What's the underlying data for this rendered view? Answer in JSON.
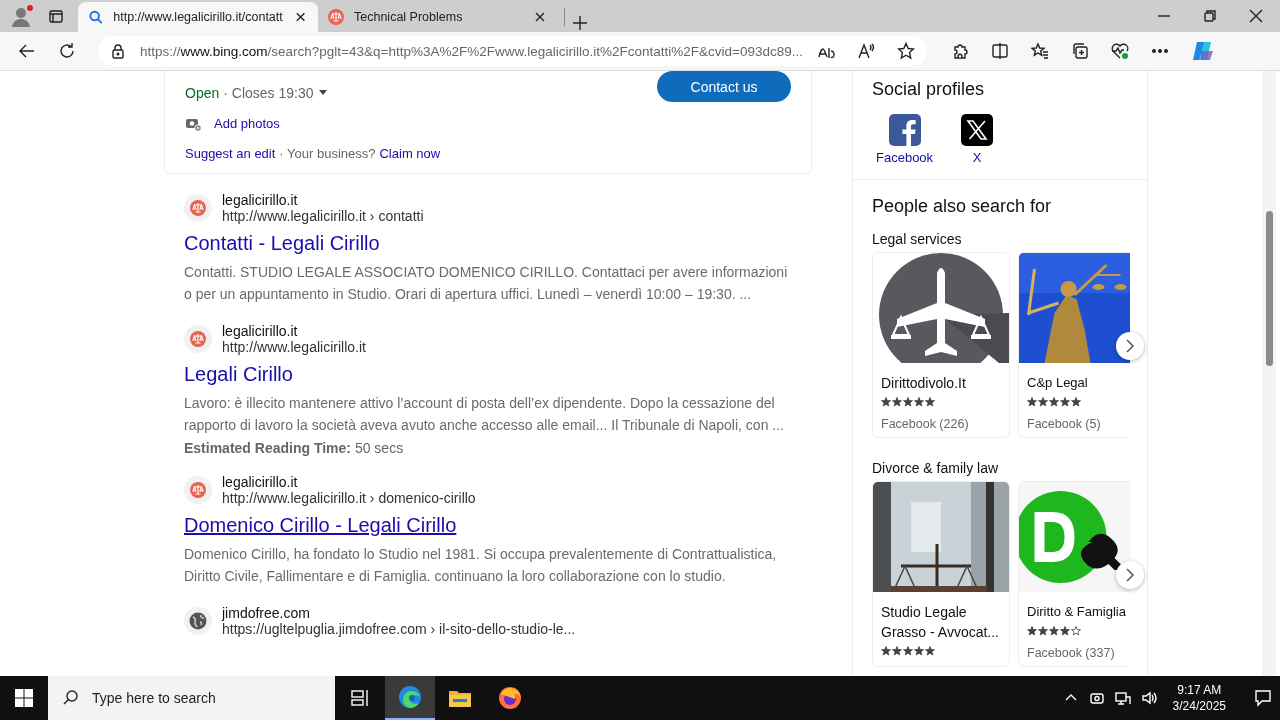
{
  "browser": {
    "tabs": [
      {
        "title": "http://www.legalicirillo.it/contatt",
        "kind": "search",
        "selected": true
      },
      {
        "title": "Technical Problems",
        "kind": "scales",
        "selected": false
      }
    ],
    "address": {
      "scheme": "https://",
      "host": "www.bing.com",
      "path": "/search?pglt=43&q=http%3A%2F%2Fwww.legalicirillo.it%2Fcontatti%2F&cvid=093dc89..."
    }
  },
  "business": {
    "status": "Open",
    "hours": "· Closes 19:30",
    "contact_button": "Contact us",
    "add_photos": "Add photos",
    "suggest_edit": "Suggest an edit",
    "your_business": "· Your business?",
    "claim": "Claim now"
  },
  "results": [
    {
      "kind": "scales",
      "site": "legalicirillo.it",
      "url": "http://www.legalicirillo.it › contatti",
      "title": "Contatti - Legali Cirillo",
      "hovered": false,
      "snippet": "Contatti. STUDIO LEGALE ASSOCIATO DOMENICO CIRILLO. Contattaci per avere informazioni o per un appuntamento in Studio. Orari di apertura uffici. Lunedì – venerdì 10:00 – 19:30. ..."
    },
    {
      "kind": "scales",
      "site": "legalicirillo.it",
      "url": "http://www.legalicirillo.it",
      "title": "Legali Cirillo",
      "hovered": false,
      "snippet": "Lavoro: è illecito mantenere attivo l’account di posta dell’ex dipendente. Dopo la cessazione del rapporto di lavoro la società aveva avuto anche accesso alle email... Il Tribunale di Napoli, con ...",
      "meta": "**Estimated Reading Time:** 50 secs"
    },
    {
      "kind": "scales",
      "site": "legalicirillo.it",
      "url": "http://www.legalicirillo.it › domenico-cirillo",
      "title": "Domenico Cirillo - Legali Cirillo",
      "hovered": true,
      "snippet": "Domenico Cirillo, ha fondato lo Studio nel 1981. Si occupa prevalentemente di Contrattualistica, Diritto Civile, Fallimentare e di Famiglia. continuano la loro collaborazione con lo studio."
    },
    {
      "kind": "globe",
      "site": "jimdofree.com",
      "url": "https://ugltelpuglia.jimdofree.com › il-sito-dello-studio-le..."
    }
  ],
  "social": {
    "title": "Social profiles",
    "profiles": [
      {
        "kind": "facebook",
        "label": "Facebook"
      },
      {
        "kind": "x",
        "label": "X"
      }
    ]
  },
  "people_also_search": {
    "title": "People also search for",
    "groups": [
      {
        "title": "Legal services",
        "items": [
          {
            "kind": "plane",
            "name": "Dirittodivolo.It",
            "stars": 5,
            "source": "Facebook (226)"
          },
          {
            "kind": "statue",
            "name": "C&p Legal",
            "stars": 5,
            "source": "Facebook (5)"
          }
        ]
      },
      {
        "title": "Divorce & family law",
        "items": [
          {
            "kind": "scales",
            "name": "Studio Legale Grasso - Avvocat...",
            "stars": 5
          },
          {
            "kind": "green",
            "name": "Diritto & Famiglia",
            "stars": 4,
            "source": "Facebook (337)"
          }
        ]
      }
    ]
  },
  "taskbar": {
    "search_placeholder": "Type here to search",
    "time": "9:17 AM",
    "date": "3/24/2025"
  }
}
